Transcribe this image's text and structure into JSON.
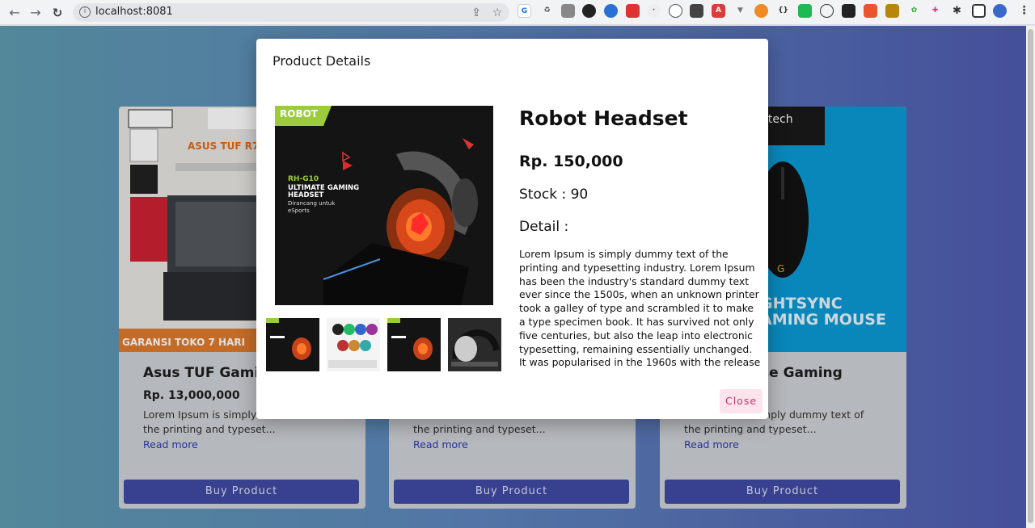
{
  "browser": {
    "url": "localhost:8081"
  },
  "page": {
    "cards": [
      {
        "title": "Asus TUF Gamin",
        "price": "Rp. 13,000,000",
        "desc_line1": "Lorem Ipsum is simply d",
        "desc_line2": "the printing and typeset...",
        "read_more": "Read more",
        "buy": "Buy Product",
        "banner_top": "ASUS TUF R7",
        "banner_bottom": "GARANSI TOKO 7 HARI"
      },
      {
        "title": "",
        "price": "",
        "desc_line1": "",
        "desc_line2": "the printing and typeset...",
        "read_more": "Read more",
        "buy": "Buy Product"
      },
      {
        "title": "se Gaming",
        "price": "",
        "desc_line1": "mply dummy text of",
        "desc_line2": "the printing and typeset...",
        "read_more": "Read more",
        "buy": "Buy Product",
        "banner_top": "itech",
        "banner_line1": "GHTSYNC",
        "banner_line2": "AMING MOUSE"
      }
    ]
  },
  "modal": {
    "title": "Product Details",
    "product_name": "Robot Headset",
    "price": "Rp. 150,000",
    "stock": "Stock : 90",
    "detail_label": "Detail :",
    "description": "Lorem Ipsum is simply dummy text of the printing and typesetting industry. Lorem Ipsum has been the industry's standard dummy text ever since the 1500s, when an unknown printer took a galley of type and scrambled it to make a type specimen book. It has survived not only five centuries, but also the leap into electronic typesetting, remaining essentially unchanged. It was popularised in the 1960s with the release of Letraset sheets containing Lorem Ipsum passages.",
    "close": "Close",
    "image_text": {
      "brand": "ROBOT",
      "model": "RH-G10",
      "tagline1": "ULTIMATE GAMING",
      "tagline2": "HEADSET",
      "sub1": "Dirancang untuk",
      "sub2": "eSports"
    }
  },
  "colors": {
    "buy_button": "#3f4aa3",
    "close_bg": "#fde4ec",
    "close_text": "#d0336c",
    "robot_green": "#9ccc3c"
  }
}
